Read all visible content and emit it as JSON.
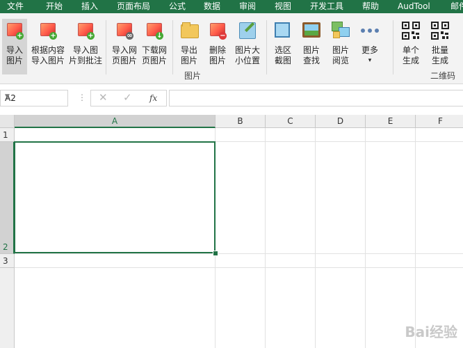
{
  "menu": {
    "items": [
      "文件",
      "开始",
      "插入",
      "页面布局",
      "公式",
      "数据",
      "审阅",
      "视图",
      "开发工具",
      "帮助",
      "AudTool",
      "邮件"
    ]
  },
  "ribbon": {
    "buttons": [
      {
        "line1": "导入",
        "line2": "图片",
        "icon": "insert-picture-icon"
      },
      {
        "line1": "根据内容",
        "line2": "导入图片",
        "icon": "insert-by-content-icon"
      },
      {
        "line1": "导入图",
        "line2": "片到批注",
        "icon": "picture-to-comment-icon"
      },
      {
        "line1": "导入网",
        "line2": "页图片",
        "icon": "web-picture-icon"
      },
      {
        "line1": "下载网",
        "line2": "页图片",
        "icon": "download-web-picture-icon"
      },
      {
        "line1": "导出",
        "line2": "图片",
        "icon": "export-picture-icon"
      },
      {
        "line1": "删除",
        "line2": "图片",
        "icon": "delete-picture-icon"
      },
      {
        "line1": "图片大",
        "line2": "小位置",
        "icon": "picture-size-position-icon"
      },
      {
        "line1": "选区",
        "line2": "截图",
        "icon": "selection-screenshot-icon"
      },
      {
        "line1": "图片",
        "line2": "查找",
        "icon": "picture-find-icon"
      },
      {
        "line1": "图片",
        "line2": "阅览",
        "icon": "picture-browse-icon"
      },
      {
        "line1": "更多",
        "line2": "▾",
        "icon": "more-dots-icon"
      },
      {
        "line1": "单个",
        "line2": "生成",
        "icon": "qr-single-icon"
      },
      {
        "line1": "批量",
        "line2": "生成",
        "icon": "qr-batch-icon"
      }
    ],
    "groups": {
      "pictures": "图片",
      "qrcode": "二维码"
    }
  },
  "formula_bar": {
    "name_box": "A2",
    "cancel": "✕",
    "enter": "✓",
    "fx": "fx",
    "value": ""
  },
  "sheet": {
    "columns": [
      "A",
      "B",
      "C",
      "D",
      "E",
      "F"
    ],
    "rows": [
      "1",
      "2",
      "3"
    ],
    "selected_cell": "A2"
  },
  "watermark": "Bai经验"
}
